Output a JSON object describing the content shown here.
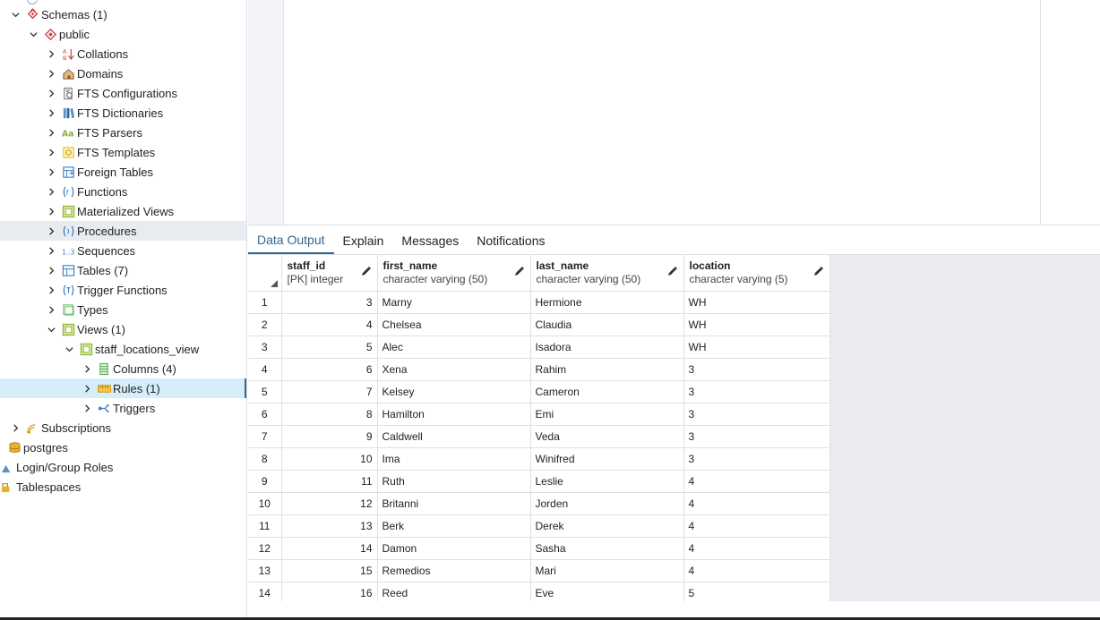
{
  "tree": {
    "items": [
      {
        "label": "Schemas (1)",
        "level": 0,
        "expanded": true,
        "icon": "schemas-icon"
      },
      {
        "label": "public",
        "level": 1,
        "expanded": true,
        "icon": "schema-icon"
      },
      {
        "label": "Collations",
        "level": 2,
        "expanded": false,
        "icon": "collations-icon"
      },
      {
        "label": "Domains",
        "level": 2,
        "expanded": false,
        "icon": "domains-icon"
      },
      {
        "label": "FTS Configurations",
        "level": 2,
        "expanded": false,
        "icon": "fts-configurations-icon"
      },
      {
        "label": "FTS Dictionaries",
        "level": 2,
        "expanded": false,
        "icon": "fts-dictionaries-icon"
      },
      {
        "label": "FTS Parsers",
        "level": 2,
        "expanded": false,
        "icon": "fts-parsers-icon"
      },
      {
        "label": "FTS Templates",
        "level": 2,
        "expanded": false,
        "icon": "fts-templates-icon"
      },
      {
        "label": "Foreign Tables",
        "level": 2,
        "expanded": false,
        "icon": "foreign-tables-icon"
      },
      {
        "label": "Functions",
        "level": 2,
        "expanded": false,
        "icon": "functions-icon"
      },
      {
        "label": "Materialized Views",
        "level": 2,
        "expanded": false,
        "icon": "materialized-views-icon"
      },
      {
        "label": "Procedures",
        "level": 2,
        "expanded": false,
        "icon": "procedures-icon",
        "state": "hover"
      },
      {
        "label": "Sequences",
        "level": 2,
        "expanded": false,
        "icon": "sequences-icon"
      },
      {
        "label": "Tables (7)",
        "level": 2,
        "expanded": false,
        "icon": "tables-icon"
      },
      {
        "label": "Trigger Functions",
        "level": 2,
        "expanded": false,
        "icon": "trigger-functions-icon"
      },
      {
        "label": "Types",
        "level": 2,
        "expanded": false,
        "icon": "types-icon"
      },
      {
        "label": "Views (1)",
        "level": 2,
        "expanded": true,
        "icon": "views-icon"
      },
      {
        "label": "staff_locations_view",
        "level": 3,
        "expanded": true,
        "icon": "view-icon"
      },
      {
        "label": "Columns (4)",
        "level": 4,
        "expanded": false,
        "icon": "columns-icon"
      },
      {
        "label": "Rules (1)",
        "level": 4,
        "expanded": false,
        "icon": "rules-icon",
        "state": "selected"
      },
      {
        "label": "Triggers",
        "level": 4,
        "expanded": false,
        "icon": "triggers-icon"
      },
      {
        "label": "Subscriptions",
        "level": 0,
        "expanded": false,
        "icon": "subscriptions-icon"
      },
      {
        "label": "postgres",
        "level": -1,
        "expanded": null,
        "icon": "database-icon"
      },
      {
        "label": "Login/Group Roles",
        "level": -2,
        "expanded": null,
        "icon": "login-roles-icon"
      },
      {
        "label": "Tablespaces",
        "level": -2,
        "expanded": null,
        "icon": "tablespaces-icon"
      }
    ]
  },
  "tabs": [
    {
      "label": "Data Output",
      "active": true
    },
    {
      "label": "Explain",
      "active": false
    },
    {
      "label": "Messages",
      "active": false
    },
    {
      "label": "Notifications",
      "active": false
    }
  ],
  "grid": {
    "columns": [
      {
        "name": "staff_id",
        "type": "[PK] integer",
        "align": "right"
      },
      {
        "name": "first_name",
        "type": "character varying (50)",
        "align": "left"
      },
      {
        "name": "last_name",
        "type": "character varying (50)",
        "align": "left"
      },
      {
        "name": "location",
        "type": "character varying (5)",
        "align": "left"
      }
    ],
    "rows": [
      [
        "1",
        "3",
        "Marny",
        "Hermione",
        "WH"
      ],
      [
        "2",
        "4",
        "Chelsea",
        "Claudia",
        "WH"
      ],
      [
        "3",
        "5",
        "Alec",
        "Isadora",
        "WH"
      ],
      [
        "4",
        "6",
        "Xena",
        "Rahim",
        "3"
      ],
      [
        "5",
        "7",
        "Kelsey",
        "Cameron",
        "3"
      ],
      [
        "6",
        "8",
        "Hamilton",
        "Emi",
        "3"
      ],
      [
        "7",
        "9",
        "Caldwell",
        "Veda",
        "3"
      ],
      [
        "8",
        "10",
        "Ima",
        "Winifred",
        "3"
      ],
      [
        "9",
        "11",
        "Ruth",
        "Leslie",
        "4"
      ],
      [
        "10",
        "12",
        "Britanni",
        "Jorden",
        "4"
      ],
      [
        "11",
        "13",
        "Berk",
        "Derek",
        "4"
      ],
      [
        "12",
        "14",
        "Damon",
        "Sasha",
        "4"
      ],
      [
        "13",
        "15",
        "Remedios",
        "Mari",
        "4"
      ],
      [
        "14",
        "16",
        "Reed",
        "Eve",
        "5"
      ]
    ]
  },
  "colors": {
    "accent": "#326690",
    "selected_row": "#d6eefa",
    "hover_row": "#e8ebef",
    "grid_empty": "#e9ebee"
  }
}
